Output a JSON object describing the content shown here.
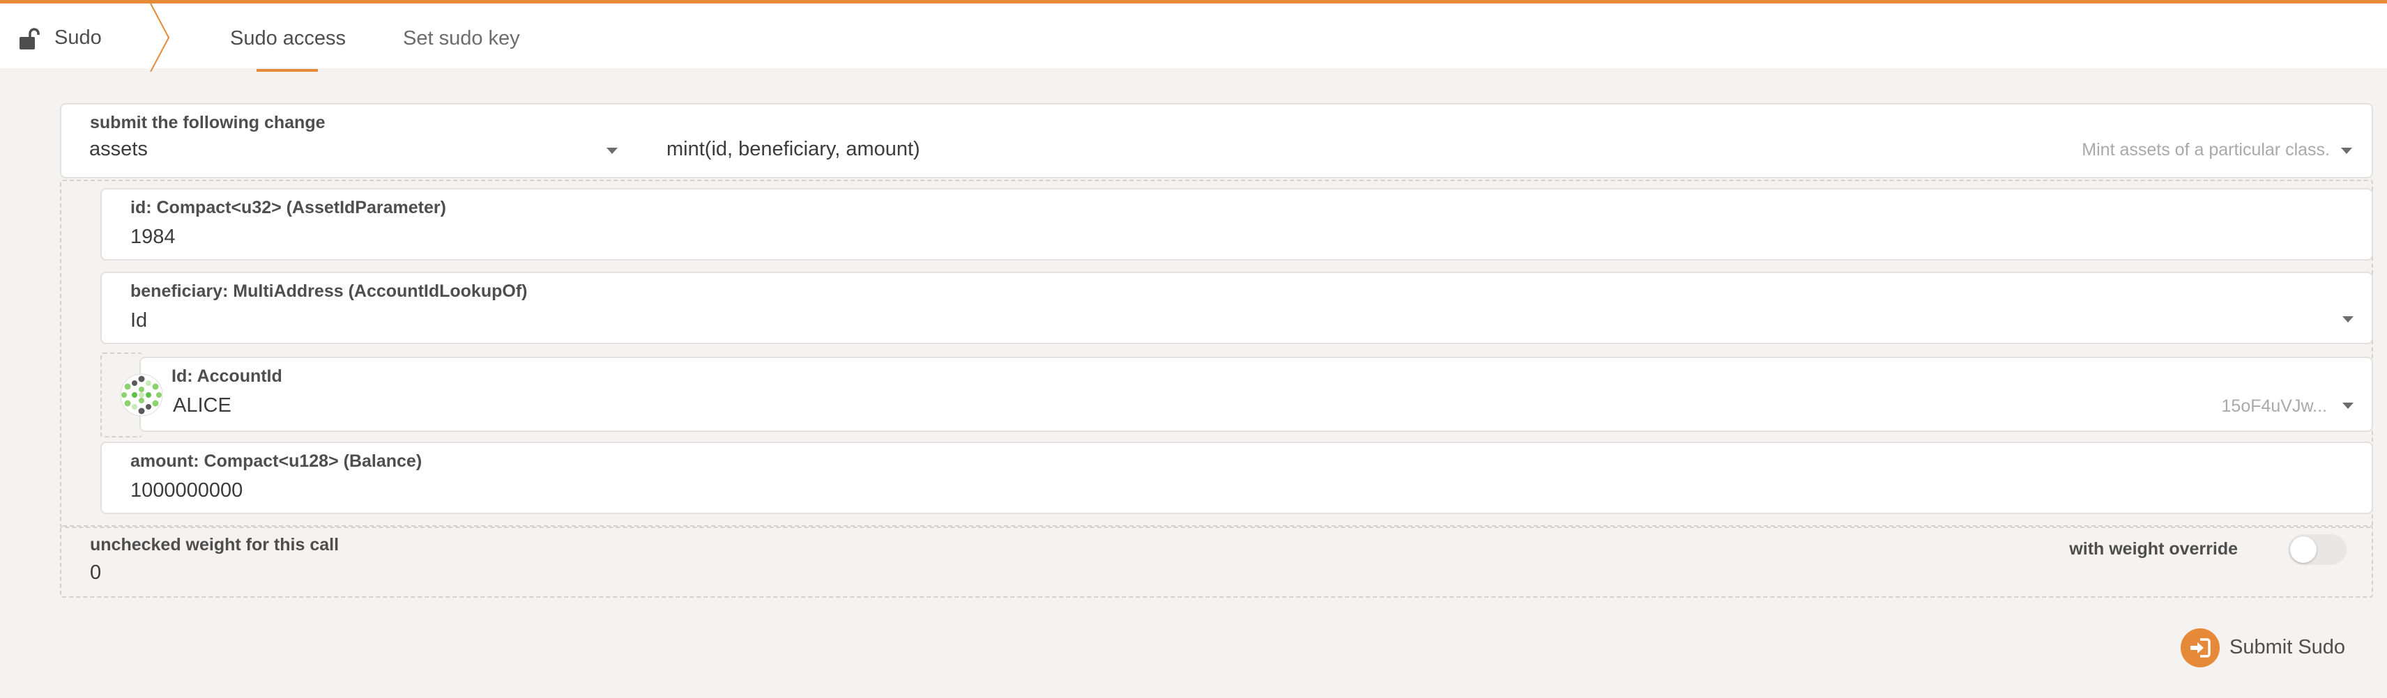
{
  "header": {
    "app_name": "Sudo",
    "tabs": [
      {
        "label": "Sudo access",
        "active": true
      },
      {
        "label": "Set sudo key",
        "active": false
      }
    ]
  },
  "call": {
    "section_label": "submit the following change",
    "module": "assets",
    "method": "mint(id, beneficiary, amount)",
    "method_hint": "Mint assets of a particular class."
  },
  "params": {
    "id": {
      "label": "id: Compact<u32> (AssetIdParameter)",
      "value": "1984"
    },
    "beneficiary": {
      "label": "beneficiary: MultiAddress (AccountIdLookupOf)",
      "value": "Id",
      "account": {
        "label": "Id: AccountId",
        "name": "ALICE",
        "address_short": "15oF4uVJw..."
      }
    },
    "amount": {
      "label": "amount: Compact<u128> (Balance)",
      "value": "1000000000"
    }
  },
  "weight": {
    "label": "unchecked weight for this call",
    "value": "0",
    "override_label": "with weight override",
    "override_enabled": false
  },
  "submit": {
    "label": "Submit Sudo"
  },
  "colors": {
    "accent": "#e68a3a",
    "background": "#f4f3f1",
    "card": "#ffffff",
    "text": "#4e4e4e",
    "muted": "#a9a9a9"
  }
}
